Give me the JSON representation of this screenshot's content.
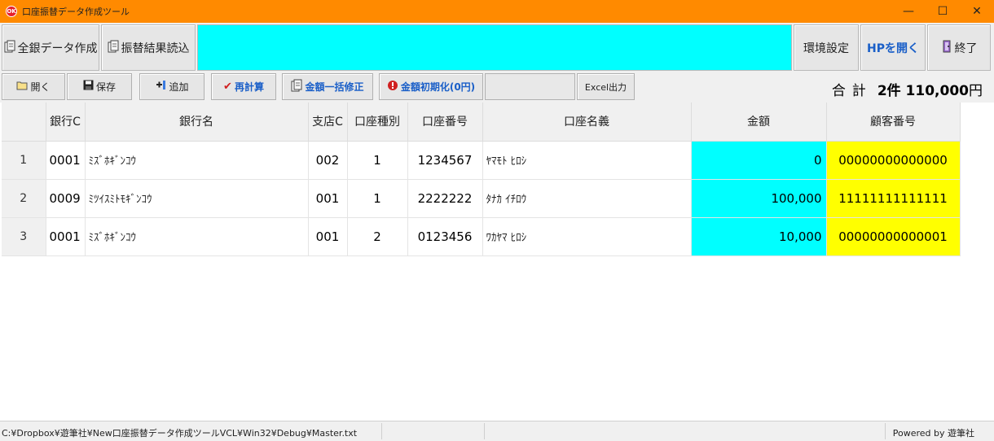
{
  "window": {
    "title": "口座振替データ作成ツール",
    "icon_text": "OK",
    "minimize": "—",
    "maximize": "☐",
    "close": "✕"
  },
  "top_toolbar": {
    "all_bank": "全銀データ作成",
    "read_results": "振替結果読込",
    "settings": "環境設定",
    "open_hp": "HPを開く",
    "exit": "終了"
  },
  "toolbar": {
    "open": "開く",
    "save": "保存",
    "add": "追加",
    "recalc": "再計算",
    "bulk_edit": "金額一括修正",
    "reset_amount": "金額初期化(0円)",
    "excel": "Excel出力",
    "total_label": "合計",
    "total_value": "2件 110,000",
    "total_unit": "円"
  },
  "table": {
    "headers": [
      "",
      "銀行C",
      "銀行名",
      "支店C",
      "口座種別",
      "口座番号",
      "口座名義",
      "金額",
      "顧客番号"
    ],
    "rows": [
      {
        "no": "1",
        "bank_code": "0001",
        "bank_name": "ﾐｽﾞﾎｷﾞﾝｺｳ",
        "branch": "002",
        "type": "1",
        "account": "1234567",
        "holder": "ﾔﾏﾓﾄ ﾋﾛｼ",
        "amount": "0",
        "customer": "00000000000000"
      },
      {
        "no": "2",
        "bank_code": "0009",
        "bank_name": "ﾐﾂｲｽﾐﾄﾓｷﾞﾝｺｳ",
        "branch": "001",
        "type": "1",
        "account": "2222222",
        "holder": "ﾀﾅｶ ｲﾁﾛｳ",
        "amount": "100,000",
        "customer": "11111111111111"
      },
      {
        "no": "3",
        "bank_code": "0001",
        "bank_name": "ﾐｽﾞﾎｷﾞﾝｺｳ",
        "branch": "001",
        "type": "2",
        "account": "0123456",
        "holder": "ﾜｶﾔﾏ ﾋﾛｼ",
        "amount": "10,000",
        "customer": "00000000000001"
      }
    ]
  },
  "statusbar": {
    "path": "C:¥Dropbox¥遊筆社¥New口座振替データ作成ツールVCL¥Win32¥Debug¥Master.txt",
    "powered": "Powered by 遊筆社"
  },
  "colors": {
    "titlebar": "#ff8a00",
    "amount_cell": "#00ffff",
    "customer_cell": "#ffff00",
    "accent_blue": "#1a5fc8",
    "recalc_red": "#d02020"
  },
  "icons": {
    "all_bank": "document-icon",
    "read_results": "document-icon",
    "exit": "door-icon",
    "open": "folder-icon",
    "save": "floppy-icon",
    "add": "add-icon",
    "recalc": "checkmark-icon",
    "bulk_edit": "document-icon",
    "reset_amount": "reset-icon"
  }
}
